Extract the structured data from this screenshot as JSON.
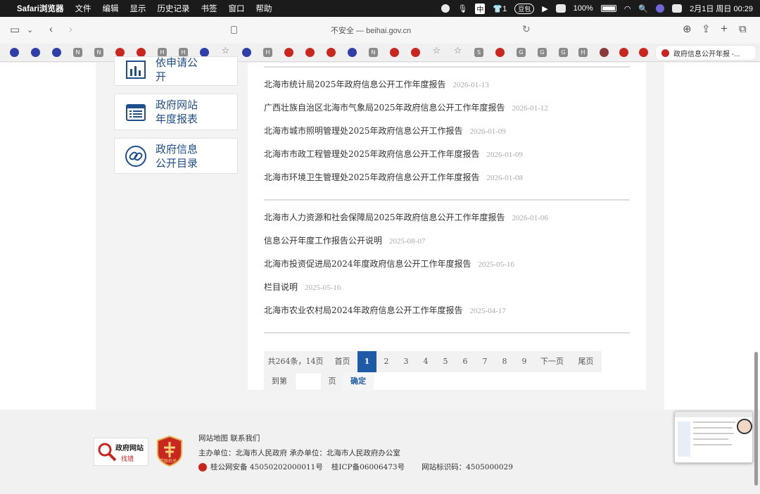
{
  "menubar": {
    "app": "Safari浏览器",
    "items": [
      "文件",
      "编辑",
      "显示",
      "历史记录",
      "书签",
      "窗口",
      "帮助"
    ],
    "ime": "中",
    "badge": "1",
    "pill": "豆包",
    "battery": "100%",
    "datetime": "2月1日 周日  00:29"
  },
  "browser": {
    "url": "不安全 — beihai.gov.cn",
    "active_tab": "政府信息公开年报 -..."
  },
  "bookmarks": [
    "N",
    "N",
    "H",
    "H",
    "H",
    "N",
    "S",
    "G",
    "G",
    "G",
    "H"
  ],
  "sidebar": {
    "cards": [
      {
        "line1": "依申请公",
        "line2": "开"
      },
      {
        "line1": "政府网站",
        "line2": "年度报表"
      },
      {
        "line1": "政府信息",
        "line2": "公开目录"
      }
    ]
  },
  "news": [
    {
      "title": "北海市统计局2025年政府信息公开工作年度报告",
      "date": "2026-01-13"
    },
    {
      "title": "广西壮族自治区北海市气象局2025年政府信息公开工作年度报告",
      "date": "2026-01-12"
    },
    {
      "title": "北海市城市照明管理处2025年政府信息公开工作报告",
      "date": "2026-01-09"
    },
    {
      "title": "北海市市政工程管理处2025年政府信息公开工作年度报告",
      "date": "2026-01-09"
    },
    {
      "title": "北海市环境卫生管理处2025年政府信息公开工作年度报告",
      "date": "2026-01-08"
    },
    {
      "title": "北海市人力资源和社会保障局2025年政府信息公开工作年度报告",
      "date": "2026-01-06"
    },
    {
      "title": "信息公开年度工作报告公开说明",
      "date": "2025-08-07"
    },
    {
      "title": "北海市投资促进局2024年度政府信息公开工作年度报告",
      "date": "2025-05-16"
    },
    {
      "title": "栏目说明",
      "date": "2025-05-16"
    },
    {
      "title": "北海市农业农村局2024年政府信息公开工作年度报告",
      "date": "2025-04-17"
    }
  ],
  "pagination": {
    "total": "共264条，14页",
    "first": "首页",
    "pages": [
      "1",
      "2",
      "3",
      "4",
      "5",
      "6",
      "7",
      "8",
      "9"
    ],
    "current": "1",
    "next": "下一页",
    "last": "尾页",
    "goto": "到第",
    "page_unit": "页",
    "confirm": "确定"
  },
  "footer": {
    "links": "网站地图  联系我们",
    "sponsor": "主办单位：北海市人民政府  承办单位：北海市人民政府办公室",
    "police": "桂公网安备 45050202000011号",
    "icp": "桂ICP备06006473号",
    "site_id": "网站标识码：4505000029",
    "logo1_line1": "政府网站",
    "logo1_line2": "找错",
    "logo2_text": "党政机关"
  },
  "colors": {
    "accent": "#1f5aa8",
    "brand_red": "#c8261f"
  }
}
